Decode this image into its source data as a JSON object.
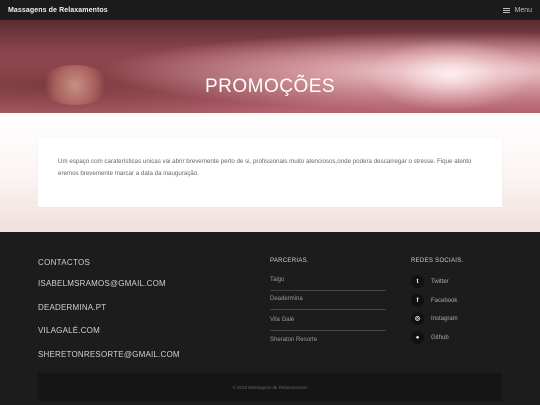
{
  "header": {
    "brand": "Massagens de Relaxamentos",
    "menu_label": "Menu"
  },
  "hero": {
    "title": "PROMOÇÕES"
  },
  "main": {
    "text": "Um espaço com caraterísticas unicas vai abrir brevemente perto de si, profissionais muito atenciosos,onde podera descarregar o stresse. Fique atento eremos brevemente marcar a data da inauguração."
  },
  "footer": {
    "contacts": {
      "title": "CONTACTOS",
      "items": [
        "ISABELMSRAMOS@GMAIL.COM",
        "DEADERMINA.PT",
        "VILAGALÉ.COM",
        "SHERETONRESORTE@GMAIL.COM"
      ]
    },
    "partners": {
      "title": "PARCERIAS.",
      "items": [
        "Talgo",
        "Deadermina",
        "Vila Galé",
        "Sheraton Resorte"
      ]
    },
    "social": {
      "title": "REDES SOCIAIS.",
      "items": [
        {
          "label": "Twitter",
          "icon": "twitter-icon",
          "glyph": "t"
        },
        {
          "label": "Facebook",
          "icon": "facebook-icon",
          "glyph": "f"
        },
        {
          "label": "Instagram",
          "icon": "instagram-icon",
          "glyph": "◎"
        },
        {
          "label": "Github",
          "icon": "github-icon",
          "glyph": "●"
        }
      ]
    },
    "copyright": "© 2019 Massagens de Relaxamentos"
  }
}
